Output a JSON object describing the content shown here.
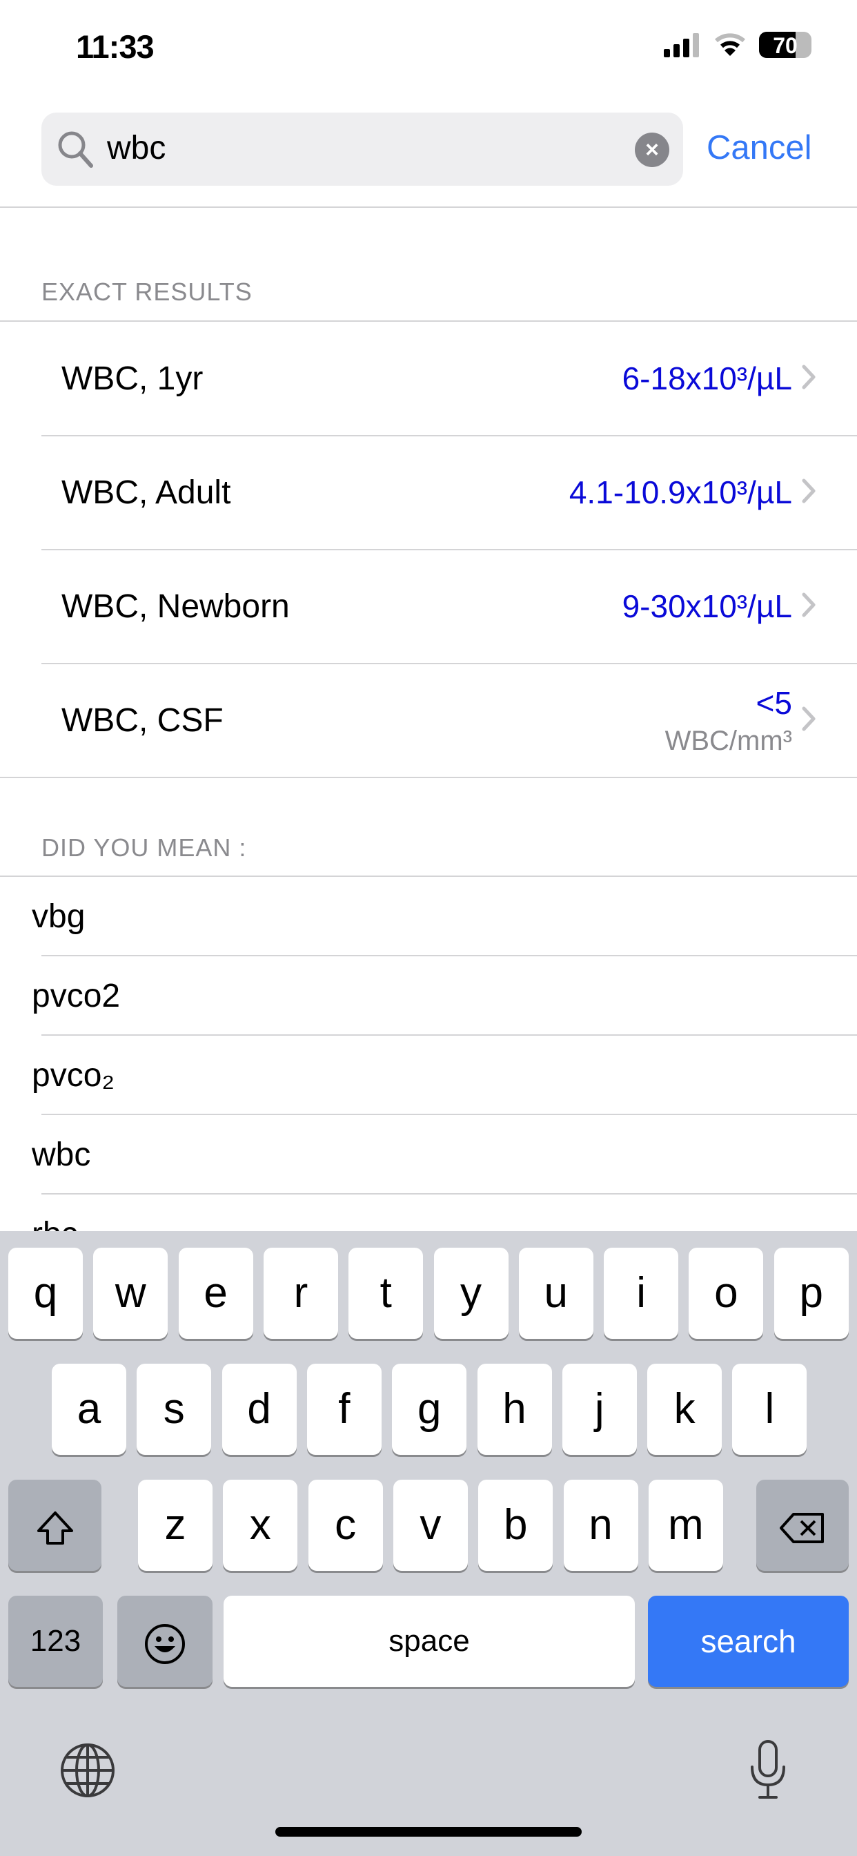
{
  "status_bar": {
    "time": "11:33",
    "battery": "70"
  },
  "search": {
    "value": "wbc",
    "cancel_label": "Cancel"
  },
  "exact_results": {
    "header": "EXACT RESULTS",
    "items": [
      {
        "label": "WBC, 1yr",
        "value": "6-18x10³/µL"
      },
      {
        "label": "WBC, Adult",
        "value": "4.1-10.9x10³/µL"
      },
      {
        "label": "WBC, Newborn",
        "value": "9-30x10³/µL"
      },
      {
        "label": "WBC, CSF",
        "value": "<5",
        "unit": "WBC/mm³"
      }
    ]
  },
  "did_you_mean": {
    "header": "DID YOU MEAN :",
    "items": [
      "vbg",
      "pvco2",
      "pvco₂",
      "wbc",
      "rbc"
    ]
  },
  "keyboard": {
    "row1": [
      "q",
      "w",
      "e",
      "r",
      "t",
      "y",
      "u",
      "i",
      "o",
      "p"
    ],
    "row2": [
      "a",
      "s",
      "d",
      "f",
      "g",
      "h",
      "j",
      "k",
      "l"
    ],
    "row3": [
      "z",
      "x",
      "c",
      "v",
      "b",
      "n",
      "m"
    ],
    "numbers_label": "123",
    "space_label": "space",
    "search_label": "search"
  },
  "colors": {
    "accent": "#3478f6",
    "value_blue": "#0a0ad8",
    "keyboard_bg": "#d1d3d9"
  }
}
